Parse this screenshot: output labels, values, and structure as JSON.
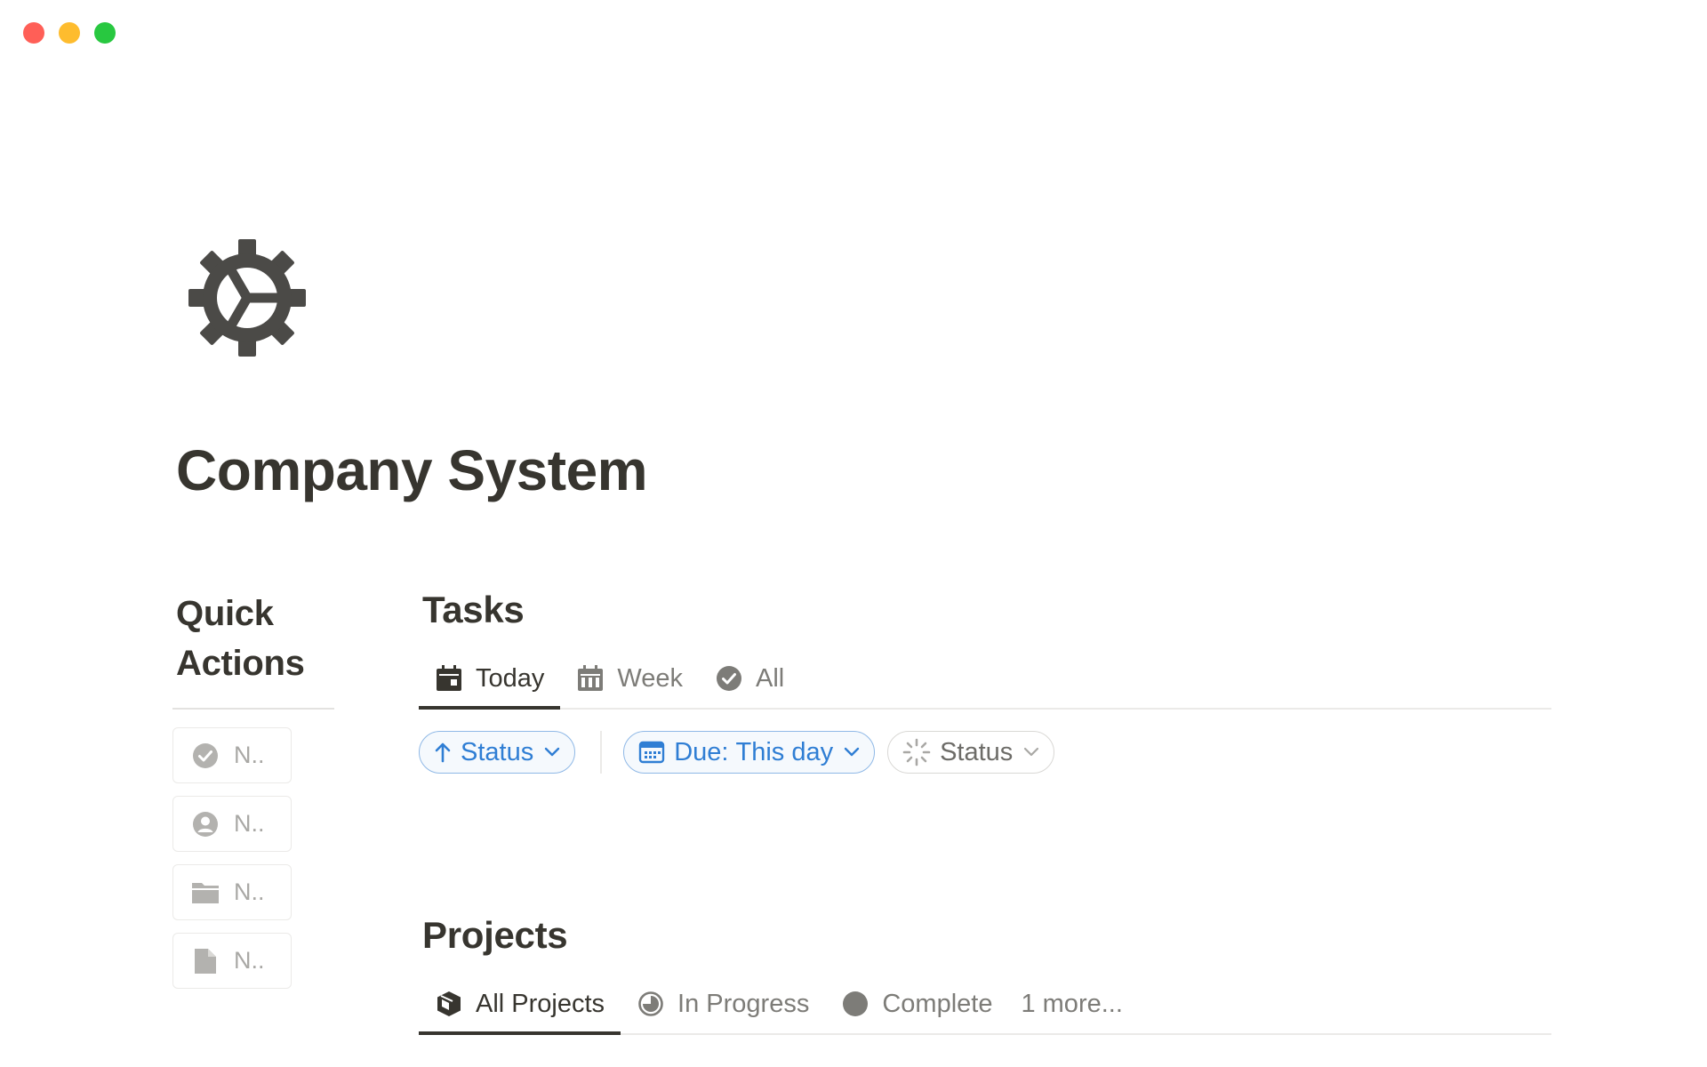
{
  "page": {
    "title": "Company System",
    "icon": "gear-icon"
  },
  "quick_actions": {
    "heading_line1": "Quick",
    "heading_line2": "Actions",
    "items": [
      {
        "label": "N..",
        "icon": "check-circle-icon"
      },
      {
        "label": "N..",
        "icon": "user-circle-icon"
      },
      {
        "label": "N..",
        "icon": "folder-icon"
      },
      {
        "label": "N..",
        "icon": "document-icon"
      }
    ]
  },
  "tasks": {
    "title": "Tasks",
    "tabs": [
      {
        "label": "Today",
        "icon": "calendar-day-icon",
        "active": true
      },
      {
        "label": "Week",
        "icon": "calendar-week-icon",
        "active": false
      },
      {
        "label": "All",
        "icon": "check-circle-icon",
        "active": false
      }
    ],
    "filters": {
      "sort_label": "Status",
      "due_prefix": "Due:",
      "due_value": "This day",
      "status_label": "Status"
    }
  },
  "projects": {
    "title": "Projects",
    "tabs": [
      {
        "label": "All Projects",
        "icon": "box-icon",
        "active": true
      },
      {
        "label": "In Progress",
        "icon": "half-circle-icon",
        "active": false
      },
      {
        "label": "Complete",
        "icon": "filled-circle-icon",
        "active": false
      }
    ],
    "more_label": "1 more..."
  },
  "colors": {
    "close": "#ff5f57",
    "minimize": "#febc2e",
    "zoom": "#28c840",
    "accent_blue": "#2f7ed4",
    "text": "#37352f"
  }
}
